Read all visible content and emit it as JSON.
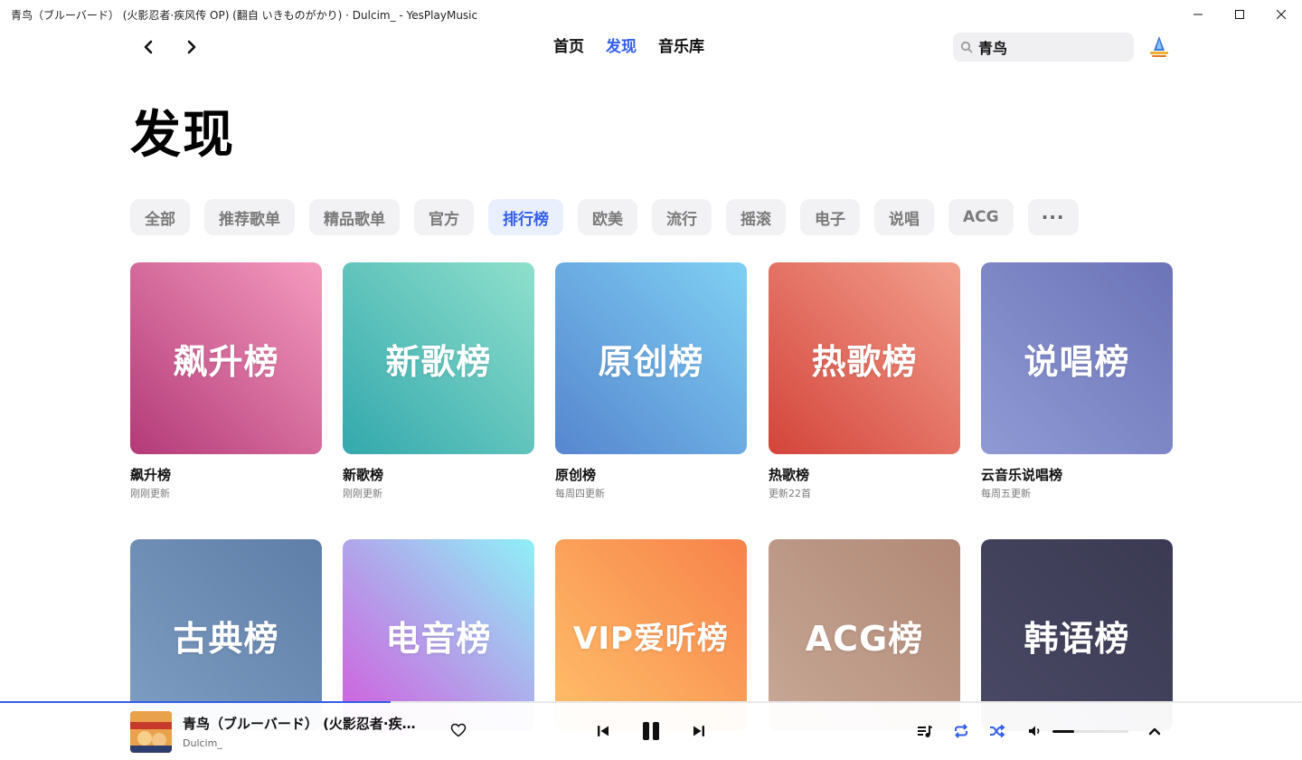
{
  "window": {
    "title": "青鸟（ブルーバード） (火影忍者·疾风传 OP)  (翻自 いきものがかり) · Dulcim_ - YesPlayMusic",
    "minimize": "—",
    "maximize": "☐",
    "close": "✕"
  },
  "nav": {
    "back_icon": "chevron-left-icon",
    "forward_icon": "chevron-right-icon",
    "links": [
      "首页",
      "发现",
      "音乐库"
    ],
    "active": "发现"
  },
  "search": {
    "value": "青鸟",
    "icon": "search-icon"
  },
  "page": {
    "title": "发现"
  },
  "categories": [
    "全部",
    "推荐歌单",
    "精品歌单",
    "官方",
    "排行榜",
    "欧美",
    "流行",
    "摇滚",
    "电子",
    "说唱",
    "ACG",
    "···"
  ],
  "active_category": "排行榜",
  "charts": [
    {
      "cover_text": "飙升榜",
      "title": "飙升榜",
      "subtitle": "刚刚更新",
      "colors": [
        "#f59bbf",
        "#b33a78"
      ]
    },
    {
      "cover_text": "新歌榜",
      "title": "新歌榜",
      "subtitle": "刚刚更新",
      "colors": [
        "#8fe0cc",
        "#33a8ad"
      ]
    },
    {
      "cover_text": "原创榜",
      "title": "原创榜",
      "subtitle": "每周四更新",
      "colors": [
        "#7fd0f4",
        "#5686cf"
      ]
    },
    {
      "cover_text": "热歌榜",
      "title": "热歌榜",
      "subtitle": "更新22首",
      "colors": [
        "#f3a08e",
        "#d4443a"
      ]
    },
    {
      "cover_text": "说唱榜",
      "title": "云音乐说唱榜",
      "subtitle": "每周五更新",
      "colors": [
        "#6c74b8",
        "#8f9ad4"
      ]
    },
    {
      "cover_text": "古典榜",
      "title": "",
      "subtitle": "",
      "colors": [
        "#5f7ea8",
        "#7f9ec2"
      ]
    },
    {
      "cover_text": "电音榜",
      "title": "",
      "subtitle": "",
      "colors": [
        "#8ff0f7",
        "#d35ade"
      ]
    },
    {
      "cover_text": "VIP爱听榜",
      "title": "",
      "subtitle": "",
      "colors": [
        "#f7824a",
        "#ffc06a"
      ]
    },
    {
      "cover_text": "ACG榜",
      "title": "",
      "subtitle": "",
      "colors": [
        "#b28876",
        "#c7a896"
      ]
    },
    {
      "cover_text": "韩语榜",
      "title": "",
      "subtitle": "",
      "colors": [
        "#3b3a52",
        "#4a4966"
      ]
    }
  ],
  "player": {
    "track": "青鸟（ブルーバード） (火影忍者·疾…",
    "artist": "Dulcim_",
    "progress": 0.3,
    "volume": 0.28,
    "accent": "#335eea",
    "icons": {
      "like": "heart-icon",
      "prev": "skip-previous-icon",
      "play_pause": "pause-icon",
      "next": "skip-next-icon",
      "playlist": "playlist-icon",
      "repeat": "repeat-icon",
      "shuffle": "shuffle-icon",
      "volume": "volume-icon",
      "expand": "chevron-up-icon"
    }
  }
}
